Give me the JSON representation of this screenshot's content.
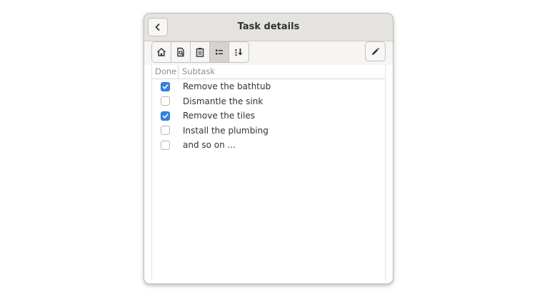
{
  "window": {
    "title": "Task details"
  },
  "header": {
    "back_icon": "chevron-left-icon"
  },
  "toolbar": {
    "buttons": [
      {
        "icon": "home-icon",
        "active": false
      },
      {
        "icon": "document-search-icon",
        "active": false
      },
      {
        "icon": "clipboard-icon",
        "active": false
      },
      {
        "icon": "list-icon",
        "active": true
      },
      {
        "icon": "move-down-icon",
        "active": false
      }
    ],
    "edit_icon": "pencil-icon"
  },
  "table": {
    "columns": [
      "Done",
      "Subtask"
    ],
    "rows": [
      {
        "done": true,
        "label": "Remove the bathtub"
      },
      {
        "done": false,
        "label": "Dismantle the sink"
      },
      {
        "done": true,
        "label": "Remove the tiles"
      },
      {
        "done": false,
        "label": "Install the plumbing"
      },
      {
        "done": false,
        "label": "and so on ..."
      }
    ]
  },
  "colors": {
    "accent": "#3584e4",
    "header_bg": "#e5e3e0",
    "text": "#2e3436"
  }
}
